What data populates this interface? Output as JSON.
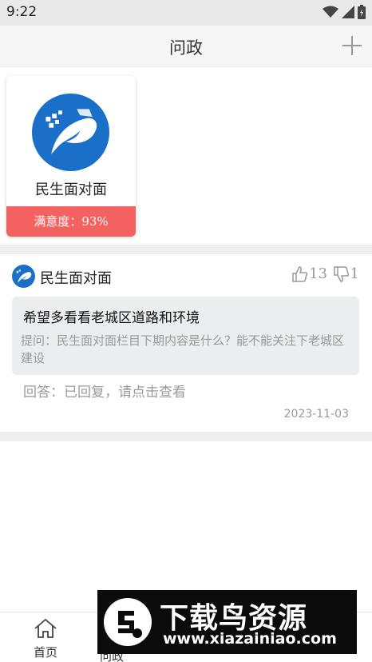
{
  "status_bar": {
    "time": "9:22"
  },
  "header": {
    "title": "问政"
  },
  "service_card": {
    "name": "民生面对面",
    "satisfaction": "满意度：93%"
  },
  "post": {
    "author": "民生面对面",
    "likes": "13",
    "dislikes": "1",
    "question_title": "希望多看看老城区道路和环境",
    "question_detail": "提问：民生面对面栏目下期内容是什么？能不能关注下老城区建设",
    "answer": "回答：已回复，请点击查看",
    "date": "2023-11-03"
  },
  "bottom_nav": {
    "home_label": "首页",
    "wz_label": "问政"
  },
  "watermark": {
    "title": "下载鸟资源",
    "url": "www.xiazainiao.com"
  },
  "colors": {
    "satisfaction_bg": "#f46161",
    "logo_blue": "#1a6fc9",
    "question_bg": "#ebedf0"
  },
  "icons": [
    "wifi-icon",
    "signal-icon",
    "battery-icon",
    "add-icon",
    "thumbs-up-icon",
    "thumbs-down-icon",
    "home-icon"
  ]
}
